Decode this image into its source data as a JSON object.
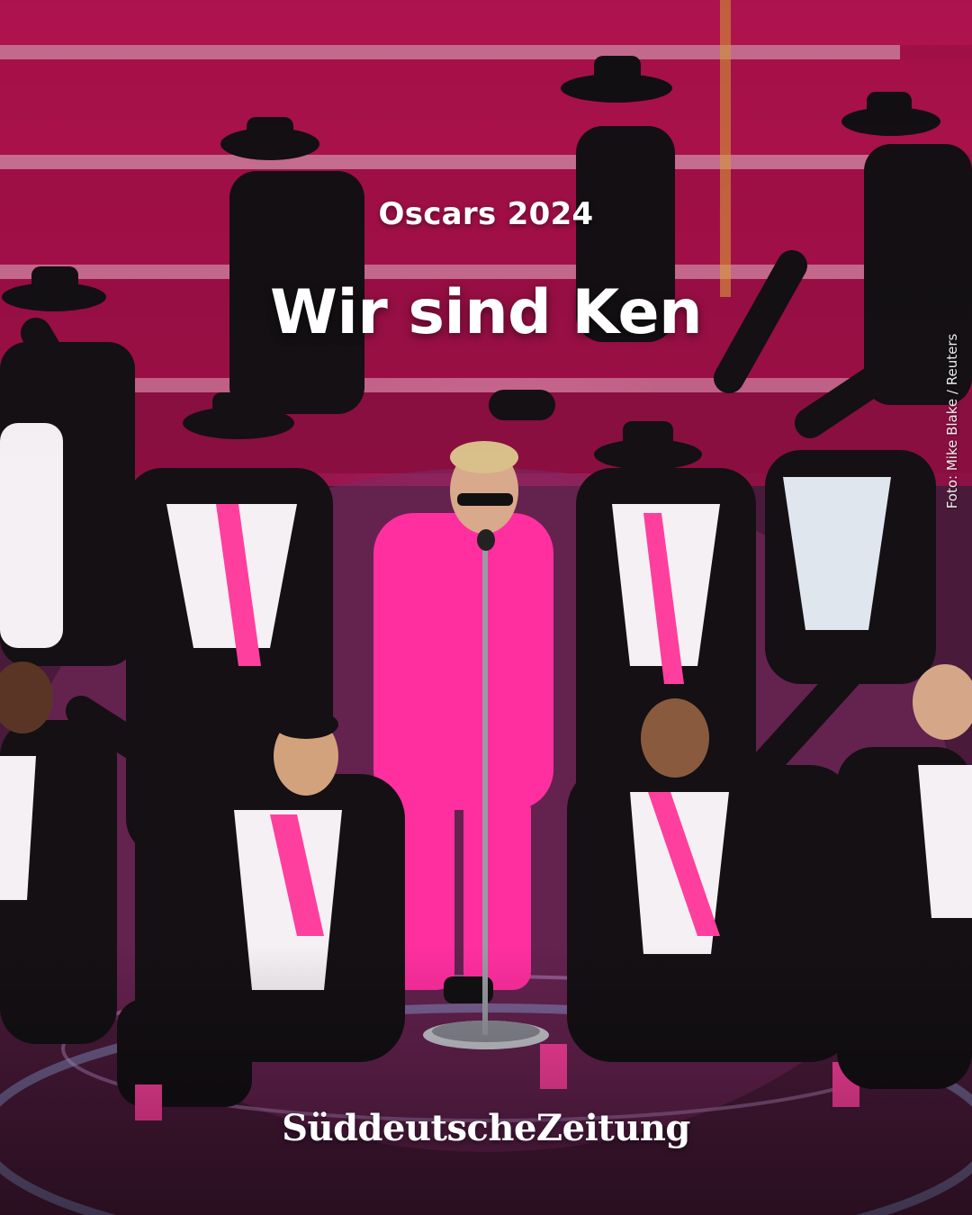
{
  "kicker": "Oscars 2024",
  "headline": "Wir sind Ken",
  "photo_credit": "Foto: Mike Blake / Reuters",
  "publication_logo": "SüddeutscheZeitung",
  "colors": {
    "stage_pink": "#b3124e",
    "suit_pink": "#ff2fa0",
    "tux_black": "#141014",
    "text_white": "#ffffff"
  }
}
